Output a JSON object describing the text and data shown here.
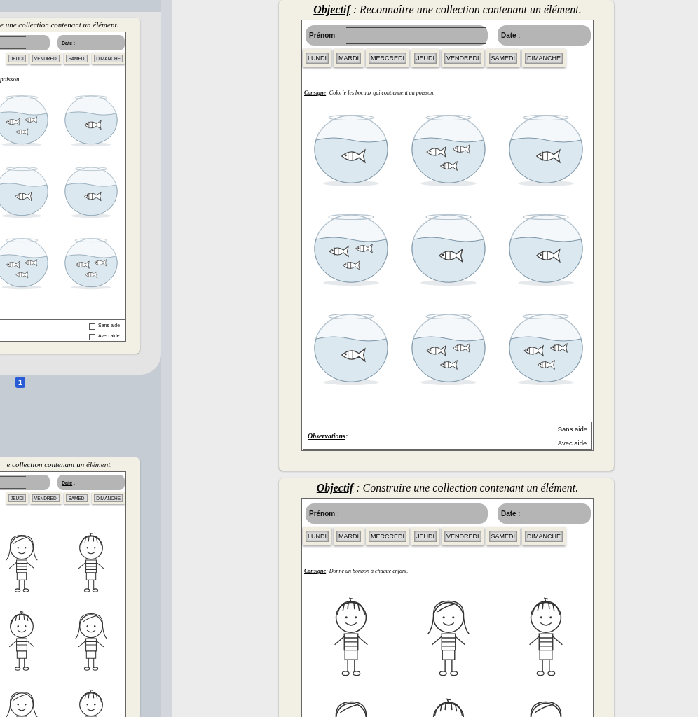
{
  "sidebar": {
    "thumbnails": [
      {
        "selected": true,
        "page_number": "1",
        "title": "e une collection contenant un élément.",
        "date_field": {
          "label": "Date",
          "suffix": ":"
        },
        "days": [
          "JEUDI",
          "VENDREDI",
          "SAMEDI",
          "DIMANCHE"
        ],
        "instruction": "poisson.",
        "items": [
          {
            "kind": "group"
          },
          {
            "kind": "single"
          },
          {
            "kind": "single"
          },
          {
            "kind": "single"
          },
          {
            "kind": "group"
          },
          {
            "kind": "group"
          }
        ],
        "checkboxes": [
          {
            "label": "Sans aide",
            "checked": false
          },
          {
            "label": "Avec aide",
            "checked": false
          }
        ]
      },
      {
        "selected": false,
        "title": "e collection contenant un élément.",
        "date_field": {
          "label": "Date",
          "suffix": ":"
        },
        "days": [
          "JEUDI",
          "VENDREDI",
          "SAMEDI",
          "DIMANCHE"
        ],
        "items": [
          {
            "kind": "girl"
          },
          {
            "kind": "boy"
          },
          {
            "kind": "boy"
          },
          {
            "kind": "girl"
          },
          {
            "kind": "girl"
          },
          {
            "kind": "boy"
          }
        ]
      }
    ]
  },
  "pages": [
    {
      "objective": {
        "label": "Objectif",
        "text": " : Reconnaître une collection contenant un élément."
      },
      "name_field": {
        "label": "Prénom",
        "suffix": ":"
      },
      "date_field": {
        "label": "Date",
        "suffix": ":"
      },
      "days": [
        "LUNDI",
        "MARDI",
        "MERCREDI",
        "JEUDI",
        "VENDREDI",
        "SAMEDI",
        "DIMANCHE"
      ],
      "instruction": {
        "label": "Consigne",
        "text": ": Colorie les bocaux qui contiennent un poisson."
      },
      "items": [
        {
          "kind": "single"
        },
        {
          "kind": "group"
        },
        {
          "kind": "single"
        },
        {
          "kind": "group"
        },
        {
          "kind": "single"
        },
        {
          "kind": "single"
        },
        {
          "kind": "single"
        },
        {
          "kind": "group"
        },
        {
          "kind": "group"
        }
      ],
      "observations": {
        "label": "Observations",
        "suffix": ":"
      },
      "checkboxes": [
        {
          "label": "Sans aide",
          "checked": false
        },
        {
          "label": "Avec aide",
          "checked": false
        }
      ]
    },
    {
      "objective": {
        "label": "Objectif",
        "text": " : Construire une collection contenant un élément."
      },
      "name_field": {
        "label": "Prénom",
        "suffix": ":"
      },
      "date_field": {
        "label": "Date",
        "suffix": ":"
      },
      "days": [
        "LUNDI",
        "MARDI",
        "MERCREDI",
        "JEUDI",
        "VENDREDI",
        "SAMEDI",
        "DIMANCHE"
      ],
      "instruction": {
        "label": "Consigne",
        "text": ": Donne un bonbon à chaque enfant."
      },
      "items": [
        {
          "kind": "boy"
        },
        {
          "kind": "girl"
        },
        {
          "kind": "boy"
        },
        {
          "kind": "girl"
        },
        {
          "kind": "boy"
        },
        {
          "kind": "girl"
        }
      ]
    }
  ]
}
